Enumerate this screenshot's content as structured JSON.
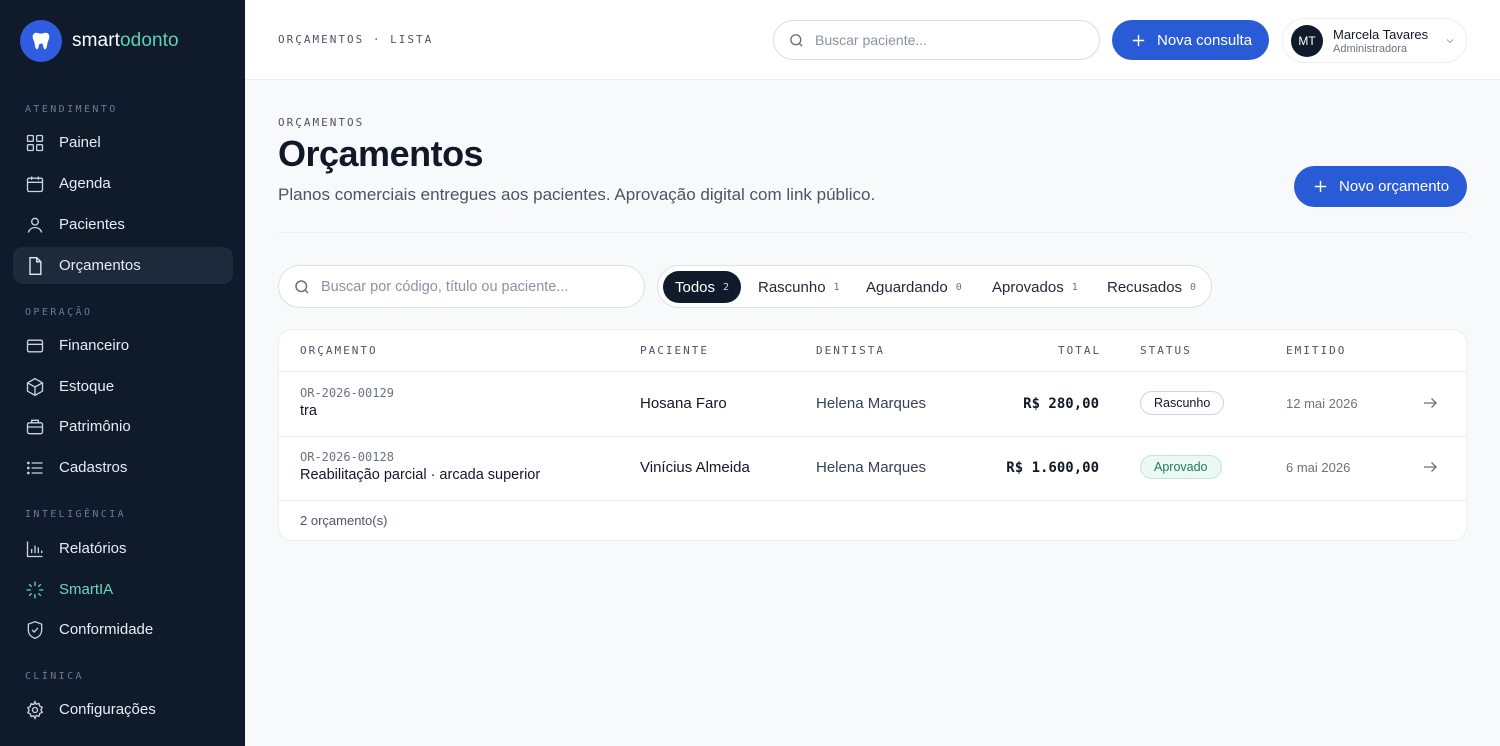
{
  "brand": {
    "name_a": "smart",
    "name_b": "odonto"
  },
  "sidebar": {
    "sections": {
      "atendimento": "ATENDIMENTO",
      "operacao": "OPERAÇÃO",
      "inteligencia": "INTELIGÊNCIA",
      "clinica": "CLÍNICA"
    },
    "items": {
      "painel": "Painel",
      "agenda": "Agenda",
      "pacientes": "Pacientes",
      "orcamentos": "Orçamentos",
      "financeiro": "Financeiro",
      "estoque": "Estoque",
      "patrimonio": "Patrimônio",
      "cadastros": "Cadastros",
      "relatorios": "Relatórios",
      "smartia": "SmartIA",
      "conformidade": "Conformidade",
      "configuracoes": "Configurações"
    },
    "active": "orcamentos"
  },
  "header": {
    "breadcrumb": "ORÇAMENTOS · LISTA",
    "search_placeholder": "Buscar paciente...",
    "new_consulta": "Nova consulta",
    "user": {
      "initials": "MT",
      "name": "Marcela Tavares",
      "role": "Administradora"
    }
  },
  "page": {
    "eyebrow": "ORÇAMENTOS",
    "title": "Orçamentos",
    "subtitle": "Planos comerciais entregues aos pacientes. Aprovação digital com link público.",
    "new_button": "Novo orçamento"
  },
  "filters": {
    "search_placeholder": "Buscar por código, título ou paciente...",
    "tabs": [
      {
        "label": "Todos",
        "count": "2",
        "active": true
      },
      {
        "label": "Rascunho",
        "count": "1"
      },
      {
        "label": "Aguardando",
        "count": "0"
      },
      {
        "label": "Aprovados",
        "count": "1"
      },
      {
        "label": "Recusados",
        "count": "0"
      }
    ]
  },
  "table": {
    "columns": {
      "orcamento": "ORÇAMENTO",
      "paciente": "PACIENTE",
      "dentista": "DENTISTA",
      "total": "TOTAL",
      "status": "STATUS",
      "emitido": "EMITIDO"
    },
    "rows": [
      {
        "code": "OR-2026-00129",
        "title": "tra",
        "patient": "Hosana Faro",
        "dentist": "Helena Marques",
        "total": "R$ 280,00",
        "status": "Rascunho",
        "issued": "12 mai 2026"
      },
      {
        "code": "OR-2026-00128",
        "title": "Reabilitação parcial · arcada superior",
        "patient": "Vinícius Almeida",
        "dentist": "Helena Marques",
        "total": "R$ 1.600,00",
        "status": "Aprovado",
        "issued": "6 mai 2026"
      }
    ],
    "footer": "2 orçamento(s)"
  },
  "colors": {
    "primary": "#2a5bd7",
    "sidebar": "#0f1a2b",
    "accent": "#5cd1b7"
  }
}
